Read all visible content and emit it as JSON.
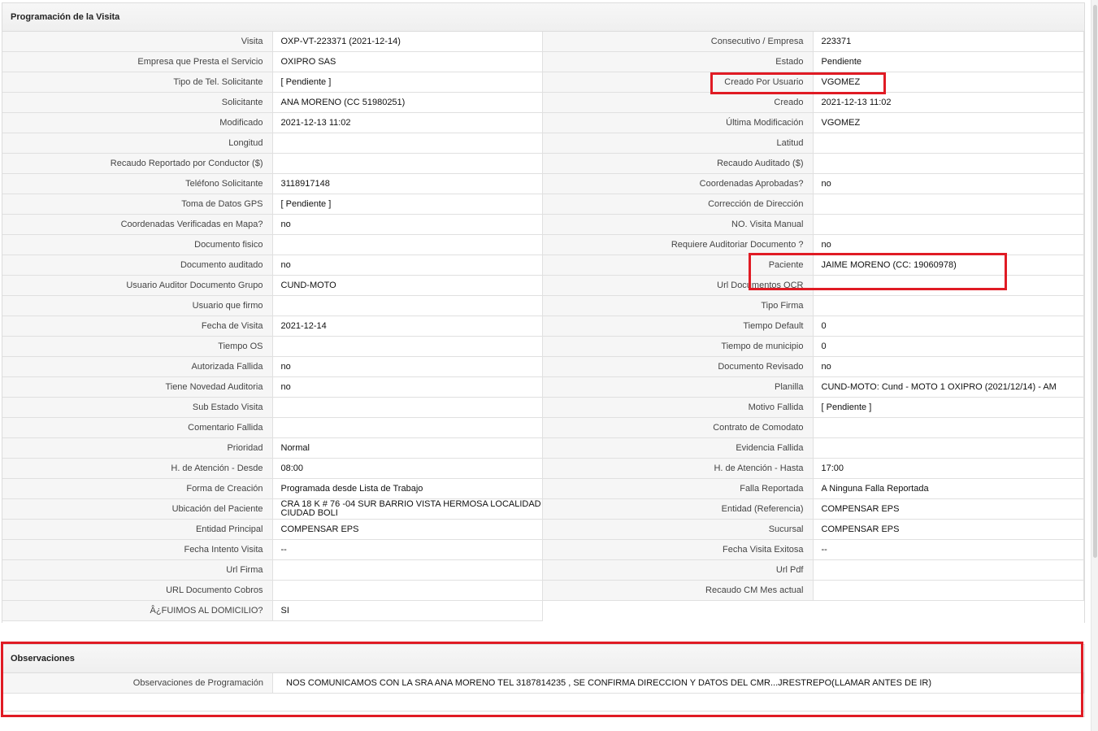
{
  "section_main": {
    "title": "Programación de la Visita",
    "rows": [
      [
        {
          "label": "Visita",
          "value": "OXP-VT-223371 (2021-12-14)"
        },
        {
          "label": "Consecutivo / Empresa",
          "value": "223371"
        }
      ],
      [
        {
          "label": "Empresa que Presta el Servicio",
          "value": "OXIPRO SAS"
        },
        {
          "label": "Estado",
          "value": "Pendiente"
        }
      ],
      [
        {
          "label": "Tipo de Tel. Solicitante",
          "value": "[ Pendiente ]"
        },
        {
          "label": "Creado Por Usuario",
          "value": "VGOMEZ"
        }
      ],
      [
        {
          "label": "Solicitante",
          "value": "ANA MORENO (CC 51980251)"
        },
        {
          "label": "Creado",
          "value": "2021-12-13 11:02"
        }
      ],
      [
        {
          "label": "Modificado",
          "value": "2021-12-13 11:02"
        },
        {
          "label": "Última Modificación",
          "value": " VGOMEZ"
        }
      ],
      [
        {
          "label": "Longitud",
          "value": ""
        },
        {
          "label": "Latitud",
          "value": ""
        }
      ],
      [
        {
          "label": "Recaudo Reportado por Conductor ($)",
          "value": ""
        },
        {
          "label": "Recaudo Auditado ($)",
          "value": ""
        }
      ],
      [
        {
          "label": "Teléfono Solicitante",
          "value": "3118917148"
        },
        {
          "label": "Coordenadas Aprobadas?",
          "value": " no"
        }
      ],
      [
        {
          "label": "Toma de Datos GPS",
          "value": "[ Pendiente ]"
        },
        {
          "label": "Corrección de Dirección",
          "value": ""
        }
      ],
      [
        {
          "label": "Coordenadas Verificadas en Mapa?",
          "value": " no"
        },
        {
          "label": "NO. Visita Manual",
          "value": ""
        }
      ],
      [
        {
          "label": "Documento fisico",
          "value": ""
        },
        {
          "label": "Requiere Auditoriar Documento ?",
          "value": " no"
        }
      ],
      [
        {
          "label": "Documento auditado",
          "value": " no"
        },
        {
          "label": "Paciente",
          "value": "JAIME MORENO (CC: 19060978)"
        }
      ],
      [
        {
          "label": "Usuario Auditor Documento Grupo",
          "value": "CUND-MOTO"
        },
        {
          "label": "Url Documentos OCR",
          "value": ""
        }
      ],
      [
        {
          "label": "Usuario que firmo",
          "value": ""
        },
        {
          "label": "Tipo Firma",
          "value": ""
        }
      ],
      [
        {
          "label": "Fecha de Visita",
          "value": " 2021-12-14"
        },
        {
          "label": "Tiempo Default",
          "value": "0"
        }
      ],
      [
        {
          "label": "Tiempo OS",
          "value": ""
        },
        {
          "label": "Tiempo de municipio",
          "value": "0"
        }
      ],
      [
        {
          "label": "Autorizada Fallida",
          "value": " no"
        },
        {
          "label": "Documento Revisado",
          "value": " no"
        }
      ],
      [
        {
          "label": "Tiene Novedad Auditoria",
          "value": " no"
        },
        {
          "label": "Planilla",
          "value": "CUND-MOTO: Cund - MOTO 1 OXIPRO (2021/12/14) - AM"
        }
      ],
      [
        {
          "label": "Sub Estado Visita",
          "value": ""
        },
        {
          "label": "Motivo Fallida",
          "value": "[ Pendiente ]"
        }
      ],
      [
        {
          "label": "Comentario Fallida",
          "value": ""
        },
        {
          "label": "Contrato de Comodato",
          "value": ""
        }
      ],
      [
        {
          "label": "Prioridad",
          "value": "Normal"
        },
        {
          "label": "Evidencia Fallida",
          "value": ""
        }
      ],
      [
        {
          "label": "H. de Atención - Desde",
          "value": "08:00"
        },
        {
          "label": "H. de Atención - Hasta",
          "value": "17:00"
        }
      ],
      [
        {
          "label": "Forma de Creación",
          "value": "Programada desde Lista de Trabajo"
        },
        {
          "label": "Falla Reportada",
          "value": "A Ninguna Falla Reportada"
        }
      ],
      [
        {
          "label": "Ubicación del Paciente",
          "value": "CRA 18 K # 76 -04 SUR BARRIO VISTA HERMOSA LOCALIDAD CIUDAD BOLI"
        },
        {
          "label": "Entidad (Referencia)",
          "value": "COMPENSAR EPS"
        }
      ],
      [
        {
          "label": "Entidad Principal",
          "value": "COMPENSAR EPS"
        },
        {
          "label": "Sucursal",
          "value": "COMPENSAR EPS"
        }
      ],
      [
        {
          "label": "Fecha Intento Visita",
          "value": " --"
        },
        {
          "label": "Fecha Visita Exitosa",
          "value": " --"
        }
      ],
      [
        {
          "label": "Url Firma",
          "value": ""
        },
        {
          "label": "Url Pdf",
          "value": ""
        }
      ],
      [
        {
          "label": "URL Documento Cobros",
          "value": ""
        },
        {
          "label": "Recaudo CM Mes actual",
          "value": ""
        }
      ],
      [
        {
          "label": "Â¿FUIMOS AL DOMICILIO?",
          "value": "SI"
        },
        null
      ]
    ]
  },
  "section_obs": {
    "title": "Observaciones",
    "label": "Observaciones de Programación",
    "value": "NOS COMUNICAMOS CON LA SRA ANA MORENO TEL 3187814235 , SE CONFIRMA DIRECCION Y DATOS DEL CMR...JRESTREPO(LLAMAR ANTES DE IR)"
  },
  "colors": {
    "highlight": "#e01b24",
    "label_bg": "#f6f6f6",
    "border": "#e0e0e0"
  }
}
